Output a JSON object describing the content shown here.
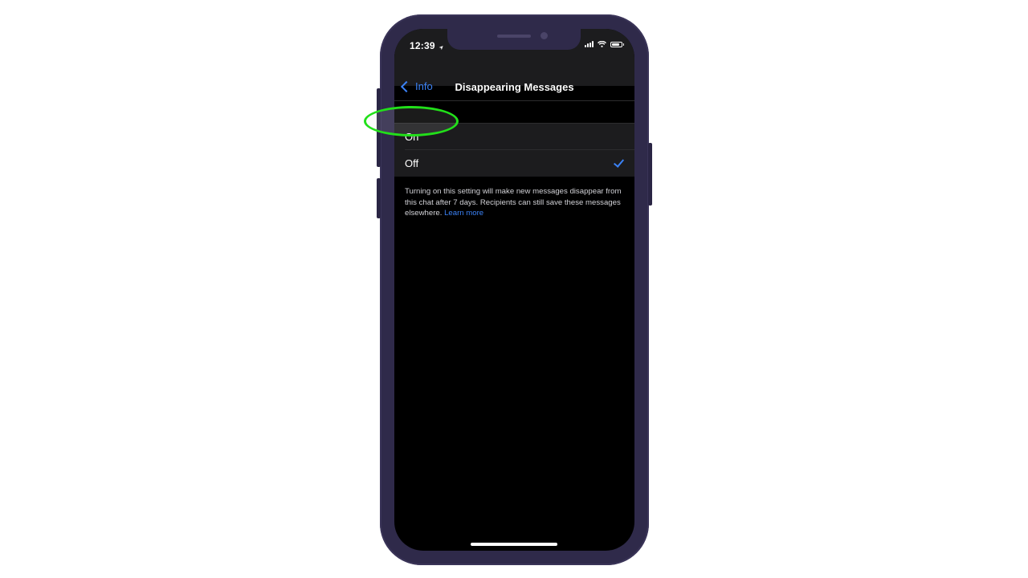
{
  "status_bar": {
    "time": "12:39",
    "location_arrow": "➤"
  },
  "nav": {
    "back_label": "Info",
    "title": "Disappearing Messages"
  },
  "options": [
    {
      "label": "On",
      "selected": false
    },
    {
      "label": "Off",
      "selected": true
    }
  ],
  "footer": {
    "text": "Turning on this setting will make new messages disappear from this chat after 7 days. Recipients can still save these messages elsewhere.",
    "link_label": "Learn more"
  },
  "colors": {
    "accent": "#3b82f6",
    "phone_frame": "#2f2a4a",
    "highlight": "#22e01a",
    "row_background": "#1c1c1e"
  },
  "icons": {
    "back": "chevron-left-icon",
    "selected": "checkmark-icon",
    "signal": "cellular-signal-icon",
    "wifi": "wifi-icon",
    "battery": "battery-icon",
    "location": "location-arrow-icon"
  }
}
